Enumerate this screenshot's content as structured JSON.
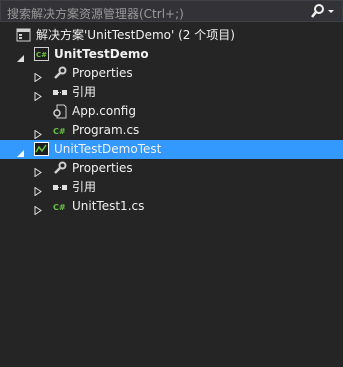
{
  "search": {
    "placeholder": "搜索解决方案资源管理器(Ctrl+;)"
  },
  "tree": {
    "solution_label": "解决方案'UnitTestDemo' (2 个项目)",
    "project1": {
      "label": "UnitTestDemo",
      "items": [
        {
          "label": "Properties"
        },
        {
          "label": "引用"
        },
        {
          "label": "App.config"
        },
        {
          "label": "Program.cs"
        }
      ]
    },
    "project2": {
      "label": "UnitTestDemoTest",
      "items": [
        {
          "label": "Properties"
        },
        {
          "label": "引用"
        },
        {
          "label": "UnitTest1.cs"
        }
      ]
    }
  },
  "colors": {
    "background": "#252526",
    "selection": "#3399ff",
    "csharp_icon": "#68c440"
  }
}
